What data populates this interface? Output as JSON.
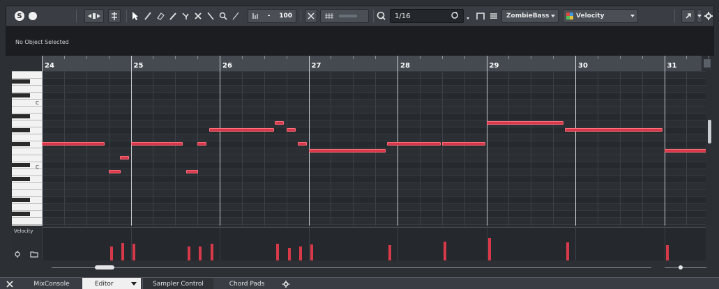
{
  "colors": {
    "note": "#d7394a",
    "note_border": "#ff6f7c",
    "toolbar_bg": "#3a3e44",
    "grid_bg": "#2b2f34",
    "info_bg": "#1b1d20"
  },
  "toolbar": {
    "solo_label": "S",
    "nudge": "-",
    "velocity_value": "100",
    "quantize_value": "1/16",
    "track_name": "ZombieBass",
    "controller_lane": "Velocity",
    "icons": [
      "solo-icon",
      "record-icon",
      "auto-scroll-icon",
      "snap-icon",
      "pointer-icon",
      "draw-icon",
      "erase-icon",
      "trim-icon",
      "split-icon",
      "glue-icon",
      "mute-icon",
      "zoom-icon",
      "line-icon",
      "velocity-icon",
      "quantize-icon",
      "mode-icon",
      "color-icon",
      "export-icon",
      "settings-icon"
    ]
  },
  "info_line": {
    "status": "No Object Selected"
  },
  "ruler": {
    "bars": [
      "24",
      "25",
      "26",
      "27",
      "28",
      "29",
      "30",
      "31"
    ]
  },
  "keyboard": {
    "c_labels": [
      "C",
      "C"
    ]
  },
  "notes": [
    {
      "bar": 24.0,
      "len": 0.72,
      "row": 10.5
    },
    {
      "bar": 24.75,
      "len": 0.15,
      "row": 14.5
    },
    {
      "bar": 24.88,
      "len": 0.12,
      "row": 12.5
    },
    {
      "bar": 25.0,
      "len": 0.6,
      "row": 10.5
    },
    {
      "bar": 25.62,
      "len": 0.15,
      "row": 14.5
    },
    {
      "bar": 25.75,
      "len": 0.12,
      "row": 10.5
    },
    {
      "bar": 25.88,
      "len": 0.75,
      "row": 8.5
    },
    {
      "bar": 26.62,
      "len": 0.12,
      "row": 7.5
    },
    {
      "bar": 26.75,
      "len": 0.12,
      "row": 8.5
    },
    {
      "bar": 26.88,
      "len": 0.12,
      "row": 10.5
    },
    {
      "bar": 27.0,
      "len": 0.88,
      "row": 11.5
    },
    {
      "bar": 27.88,
      "len": 0.62,
      "row": 10.5
    },
    {
      "bar": 28.5,
      "len": 0.5,
      "row": 10.5
    },
    {
      "bar": 29.0,
      "len": 0.88,
      "row": 7.5
    },
    {
      "bar": 29.88,
      "len": 1.12,
      "row": 8.5
    },
    {
      "bar": 31.0,
      "len": 0.5,
      "row": 11.5
    }
  ],
  "velocity": {
    "label": "Velocity",
    "values": [
      {
        "bar": 24.75,
        "value": 60
      },
      {
        "bar": 24.88,
        "value": 75
      },
      {
        "bar": 25.0,
        "value": 72
      },
      {
        "bar": 25.62,
        "value": 62
      },
      {
        "bar": 25.75,
        "value": 62
      },
      {
        "bar": 25.88,
        "value": 72
      },
      {
        "bar": 26.62,
        "value": 72
      },
      {
        "bar": 26.75,
        "value": 55
      },
      {
        "bar": 26.88,
        "value": 60
      },
      {
        "bar": 27.0,
        "value": 70
      },
      {
        "bar": 27.88,
        "value": 66
      },
      {
        "bar": 28.5,
        "value": 82
      },
      {
        "bar": 29.0,
        "value": 95
      },
      {
        "bar": 29.88,
        "value": 78
      },
      {
        "bar": 31.0,
        "value": 65
      }
    ]
  },
  "tabs": [
    {
      "label": "MixConsole"
    },
    {
      "label": "Editor"
    },
    {
      "label": "Sampler Control"
    },
    {
      "label": "Chord Pads"
    }
  ]
}
